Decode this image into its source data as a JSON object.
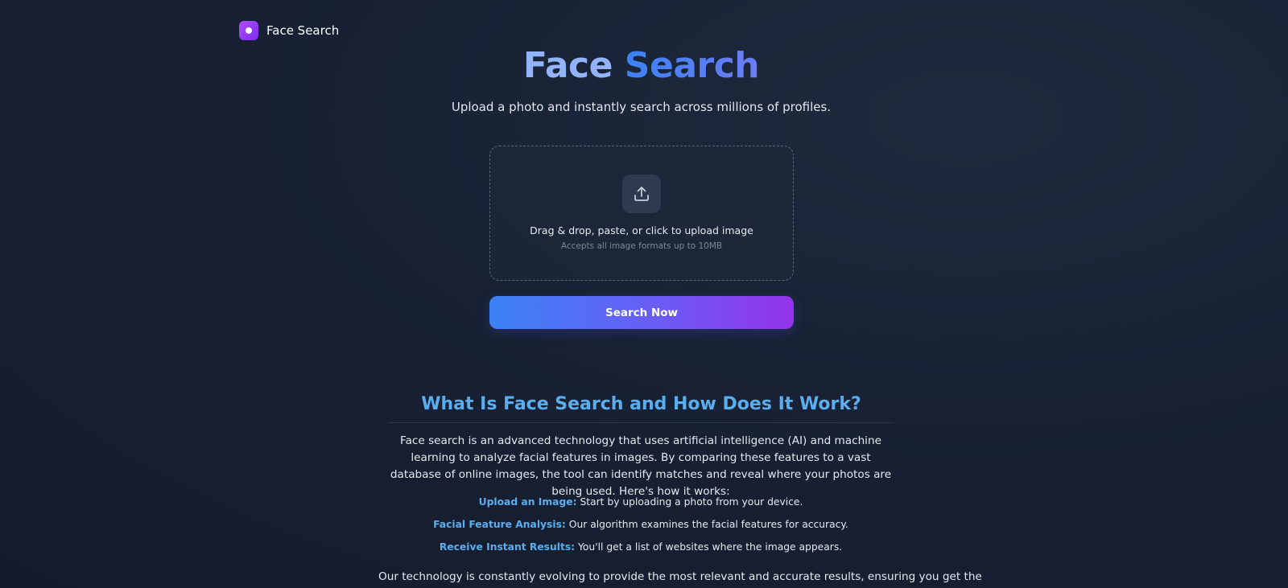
{
  "brand": {
    "name": "Face Search",
    "icon": "face-search-logo-icon"
  },
  "hero": {
    "title_part1": "Face",
    "title_part2": "Search",
    "subtitle": "Upload a photo and instantly search across millions of profiles."
  },
  "upload": {
    "icon": "upload-icon",
    "title": "Drag & drop, paste, or click to upload image",
    "hint": "Accepts all image formats up to 10MB"
  },
  "search_button": {
    "label": "Search Now"
  },
  "info": {
    "title": "What Is Face Search and How Does It Work?",
    "body": "Face search is an advanced technology that uses artificial intelligence (AI) and machine learning to analyze facial features in images. By comparing these features to a vast database of online images, the tool can identify matches and reveal where your photos are being used. Here's how it works:",
    "steps": [
      {
        "label": "Upload an Image:",
        "text": "Start by uploading a photo from your device."
      },
      {
        "label": "Facial Feature Analysis:",
        "text": "Our algorithm examines the facial features for accuracy."
      },
      {
        "label": "Receive Instant Results:",
        "text": "You'll get a list of websites where the image appears."
      }
    ],
    "closing": "Our technology is constantly evolving to provide the most relevant and accurate results, ensuring you get the"
  },
  "colors": {
    "background": "#182235",
    "accent_blue": "#5aaef0",
    "button_gradient_start": "#3b82f6",
    "button_gradient_end": "#9333ea"
  }
}
